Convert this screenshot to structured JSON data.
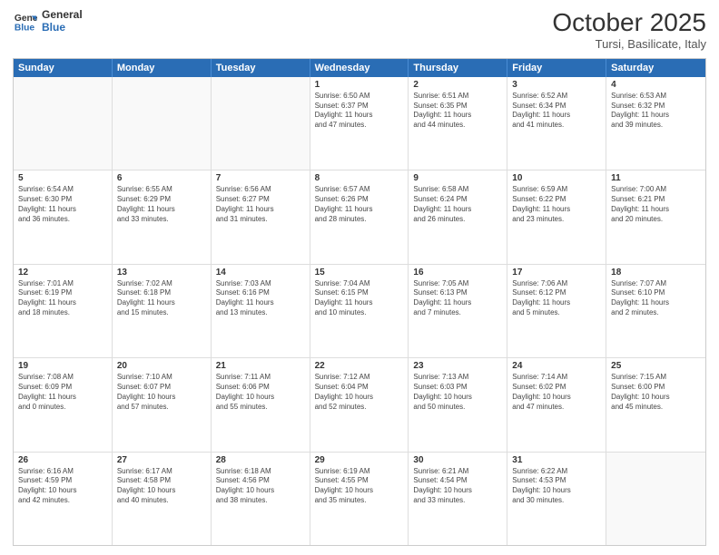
{
  "header": {
    "logo_general": "General",
    "logo_blue": "Blue",
    "month_title": "October 2025",
    "location": "Tursi, Basilicate, Italy"
  },
  "weekdays": [
    "Sunday",
    "Monday",
    "Tuesday",
    "Wednesday",
    "Thursday",
    "Friday",
    "Saturday"
  ],
  "rows": [
    [
      {
        "day": "",
        "info": ""
      },
      {
        "day": "",
        "info": ""
      },
      {
        "day": "",
        "info": ""
      },
      {
        "day": "1",
        "info": "Sunrise: 6:50 AM\nSunset: 6:37 PM\nDaylight: 11 hours\nand 47 minutes."
      },
      {
        "day": "2",
        "info": "Sunrise: 6:51 AM\nSunset: 6:35 PM\nDaylight: 11 hours\nand 44 minutes."
      },
      {
        "day": "3",
        "info": "Sunrise: 6:52 AM\nSunset: 6:34 PM\nDaylight: 11 hours\nand 41 minutes."
      },
      {
        "day": "4",
        "info": "Sunrise: 6:53 AM\nSunset: 6:32 PM\nDaylight: 11 hours\nand 39 minutes."
      }
    ],
    [
      {
        "day": "5",
        "info": "Sunrise: 6:54 AM\nSunset: 6:30 PM\nDaylight: 11 hours\nand 36 minutes."
      },
      {
        "day": "6",
        "info": "Sunrise: 6:55 AM\nSunset: 6:29 PM\nDaylight: 11 hours\nand 33 minutes."
      },
      {
        "day": "7",
        "info": "Sunrise: 6:56 AM\nSunset: 6:27 PM\nDaylight: 11 hours\nand 31 minutes."
      },
      {
        "day": "8",
        "info": "Sunrise: 6:57 AM\nSunset: 6:26 PM\nDaylight: 11 hours\nand 28 minutes."
      },
      {
        "day": "9",
        "info": "Sunrise: 6:58 AM\nSunset: 6:24 PM\nDaylight: 11 hours\nand 26 minutes."
      },
      {
        "day": "10",
        "info": "Sunrise: 6:59 AM\nSunset: 6:22 PM\nDaylight: 11 hours\nand 23 minutes."
      },
      {
        "day": "11",
        "info": "Sunrise: 7:00 AM\nSunset: 6:21 PM\nDaylight: 11 hours\nand 20 minutes."
      }
    ],
    [
      {
        "day": "12",
        "info": "Sunrise: 7:01 AM\nSunset: 6:19 PM\nDaylight: 11 hours\nand 18 minutes."
      },
      {
        "day": "13",
        "info": "Sunrise: 7:02 AM\nSunset: 6:18 PM\nDaylight: 11 hours\nand 15 minutes."
      },
      {
        "day": "14",
        "info": "Sunrise: 7:03 AM\nSunset: 6:16 PM\nDaylight: 11 hours\nand 13 minutes."
      },
      {
        "day": "15",
        "info": "Sunrise: 7:04 AM\nSunset: 6:15 PM\nDaylight: 11 hours\nand 10 minutes."
      },
      {
        "day": "16",
        "info": "Sunrise: 7:05 AM\nSunset: 6:13 PM\nDaylight: 11 hours\nand 7 minutes."
      },
      {
        "day": "17",
        "info": "Sunrise: 7:06 AM\nSunset: 6:12 PM\nDaylight: 11 hours\nand 5 minutes."
      },
      {
        "day": "18",
        "info": "Sunrise: 7:07 AM\nSunset: 6:10 PM\nDaylight: 11 hours\nand 2 minutes."
      }
    ],
    [
      {
        "day": "19",
        "info": "Sunrise: 7:08 AM\nSunset: 6:09 PM\nDaylight: 11 hours\nand 0 minutes."
      },
      {
        "day": "20",
        "info": "Sunrise: 7:10 AM\nSunset: 6:07 PM\nDaylight: 10 hours\nand 57 minutes."
      },
      {
        "day": "21",
        "info": "Sunrise: 7:11 AM\nSunset: 6:06 PM\nDaylight: 10 hours\nand 55 minutes."
      },
      {
        "day": "22",
        "info": "Sunrise: 7:12 AM\nSunset: 6:04 PM\nDaylight: 10 hours\nand 52 minutes."
      },
      {
        "day": "23",
        "info": "Sunrise: 7:13 AM\nSunset: 6:03 PM\nDaylight: 10 hours\nand 50 minutes."
      },
      {
        "day": "24",
        "info": "Sunrise: 7:14 AM\nSunset: 6:02 PM\nDaylight: 10 hours\nand 47 minutes."
      },
      {
        "day": "25",
        "info": "Sunrise: 7:15 AM\nSunset: 6:00 PM\nDaylight: 10 hours\nand 45 minutes."
      }
    ],
    [
      {
        "day": "26",
        "info": "Sunrise: 6:16 AM\nSunset: 4:59 PM\nDaylight: 10 hours\nand 42 minutes."
      },
      {
        "day": "27",
        "info": "Sunrise: 6:17 AM\nSunset: 4:58 PM\nDaylight: 10 hours\nand 40 minutes."
      },
      {
        "day": "28",
        "info": "Sunrise: 6:18 AM\nSunset: 4:56 PM\nDaylight: 10 hours\nand 38 minutes."
      },
      {
        "day": "29",
        "info": "Sunrise: 6:19 AM\nSunset: 4:55 PM\nDaylight: 10 hours\nand 35 minutes."
      },
      {
        "day": "30",
        "info": "Sunrise: 6:21 AM\nSunset: 4:54 PM\nDaylight: 10 hours\nand 33 minutes."
      },
      {
        "day": "31",
        "info": "Sunrise: 6:22 AM\nSunset: 4:53 PM\nDaylight: 10 hours\nand 30 minutes."
      },
      {
        "day": "",
        "info": ""
      }
    ]
  ]
}
